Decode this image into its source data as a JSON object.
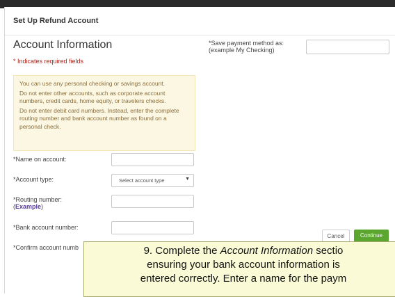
{
  "dialog": {
    "title": "Set Up Refund Account"
  },
  "form": {
    "section_title": "Account Information",
    "required_note": "* Indicates required fields",
    "notice": [
      "You can use any personal checking or savings account.",
      "Do not enter other accounts, such as corporate account numbers, credit cards, home equity, or travelers checks.",
      "Do not enter debit card numbers. Instead, enter the complete routing number and bank account number as found on a personal check."
    ],
    "name_label": "*Name on account:",
    "name_value": "",
    "account_type_label": "*Account type:",
    "account_type_value": "Select account type",
    "routing_label": "*Routing number:",
    "routing_example_open": "(",
    "routing_example_link": "Example",
    "routing_example_close": ")",
    "routing_value": "",
    "bank_label": "*Bank account number:",
    "bank_value": "",
    "confirm_label": "*Confirm account numb",
    "save_label_line1": "*Save payment method as:",
    "save_label_line2": "(example My Checking)",
    "save_value": ""
  },
  "buttons": {
    "cancel": "Cancel",
    "continue": "Continue"
  },
  "colors": {
    "continue_bg": "#5aa62e",
    "required_red": "#b0261e",
    "notice_bg": "#fbf7e3",
    "caption_bg": "#fafbd6"
  },
  "caption": {
    "line1_pre": "9. Complete the ",
    "line1_italic": "Account Information",
    "line1_post": " sectio",
    "line2": "ensuring your bank account information is",
    "line3": "entered correctly. Enter a name for the paym"
  }
}
